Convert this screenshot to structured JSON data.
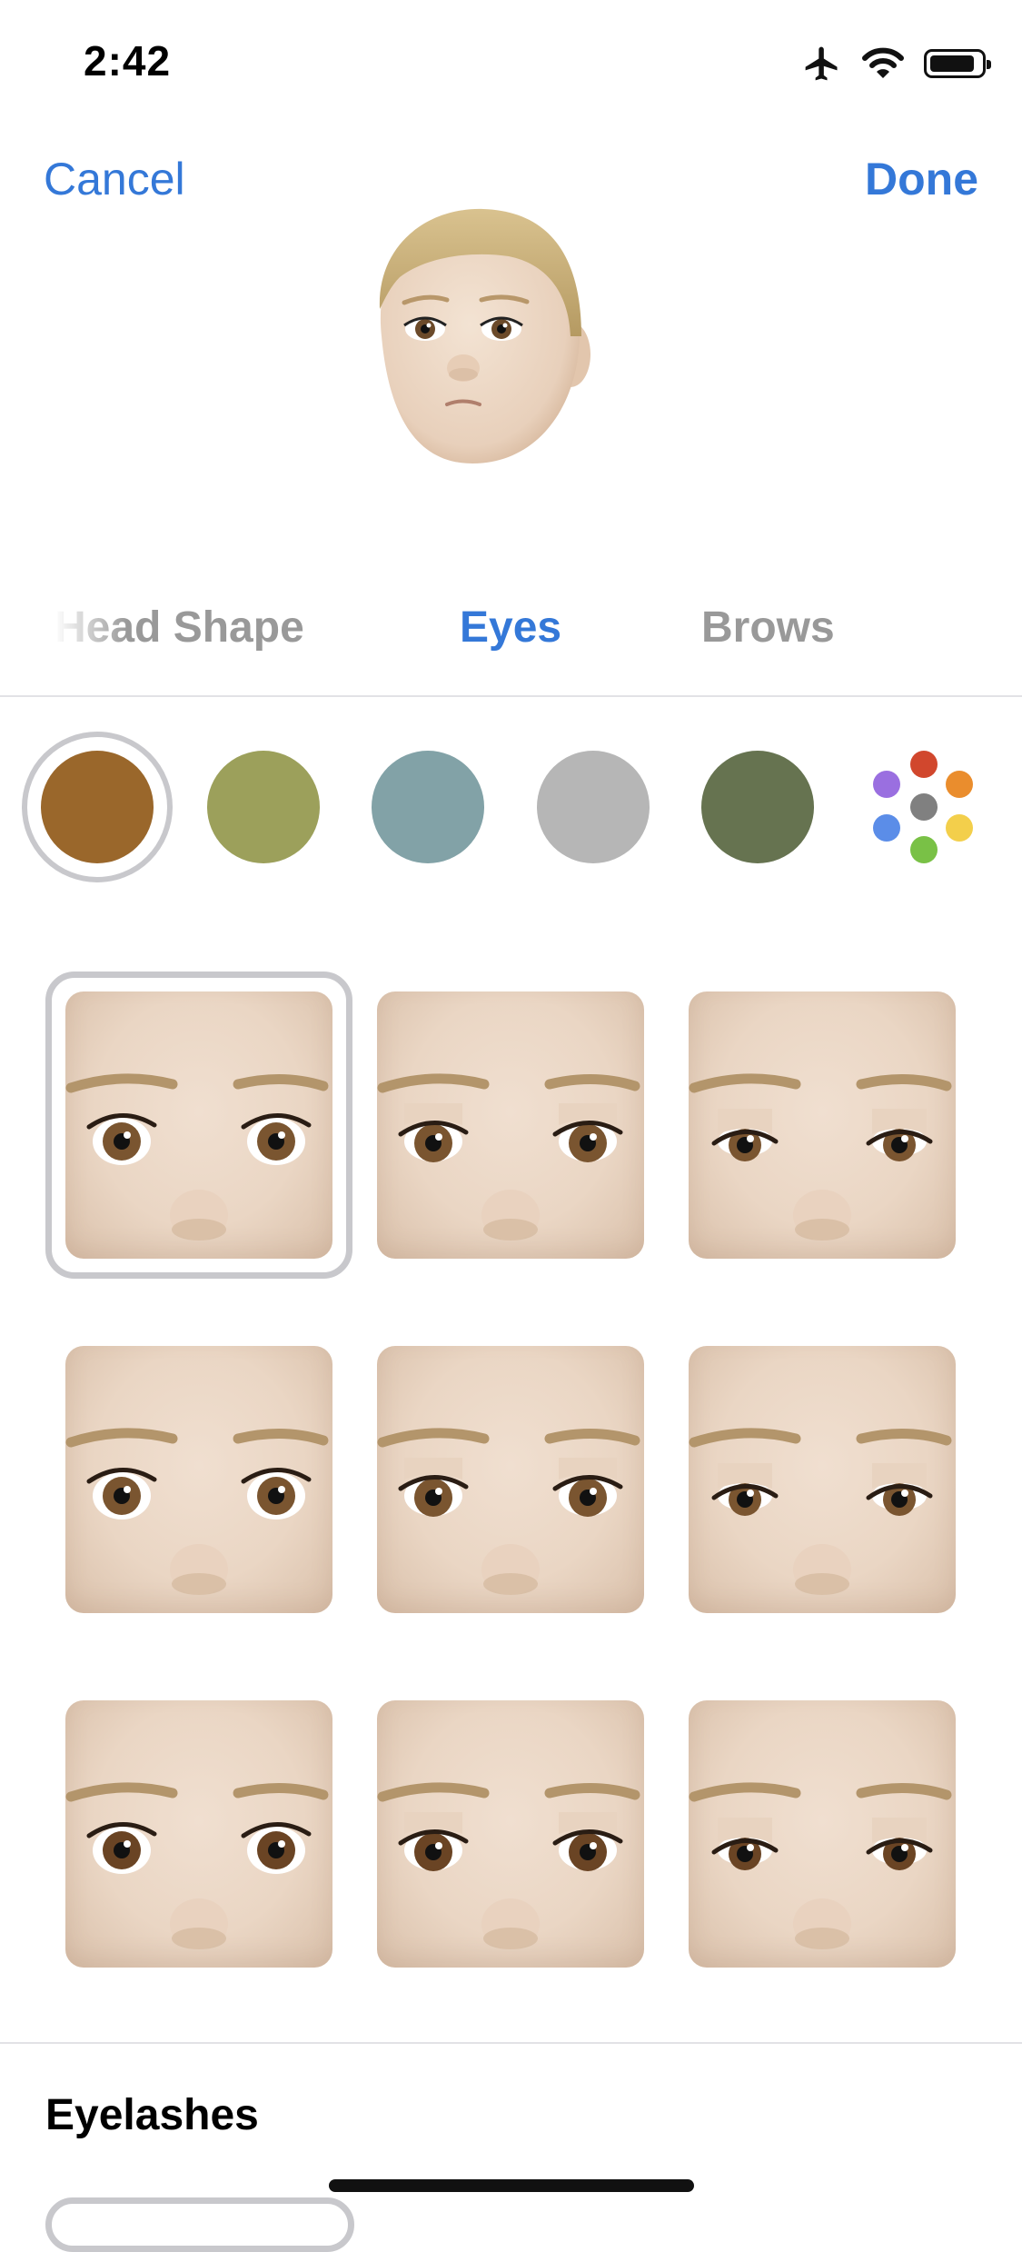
{
  "status_bar": {
    "time": "2:42",
    "icons": [
      "airplane-icon",
      "wifi-icon",
      "battery-icon"
    ]
  },
  "nav": {
    "cancel_label": "Cancel",
    "done_label": "Done"
  },
  "tabs": [
    {
      "label": "Head Shape",
      "selected": false
    },
    {
      "label": "Eyes",
      "selected": true
    },
    {
      "label": "Brows",
      "selected": false
    }
  ],
  "eye_colors": {
    "selected_index": 0,
    "swatches": [
      "#9a672b",
      "#9ca05b",
      "#82a2a7",
      "#b6b6b6",
      "#667350"
    ],
    "more_colors_icon": "color-palette-icon",
    "palette_dots": [
      "#d1472d",
      "#ea8d2d",
      "#f3cf4b",
      "#79c146",
      "#5b8de8",
      "#9a6fe0",
      "#808080"
    ]
  },
  "eye_styles": {
    "selected_index": 0,
    "count": 9
  },
  "eyelashes": {
    "title": "Eyelashes"
  },
  "colors": {
    "accent": "#3478d8",
    "inactive_tab": "#999999",
    "selection_ring": "#c8c8cc"
  }
}
